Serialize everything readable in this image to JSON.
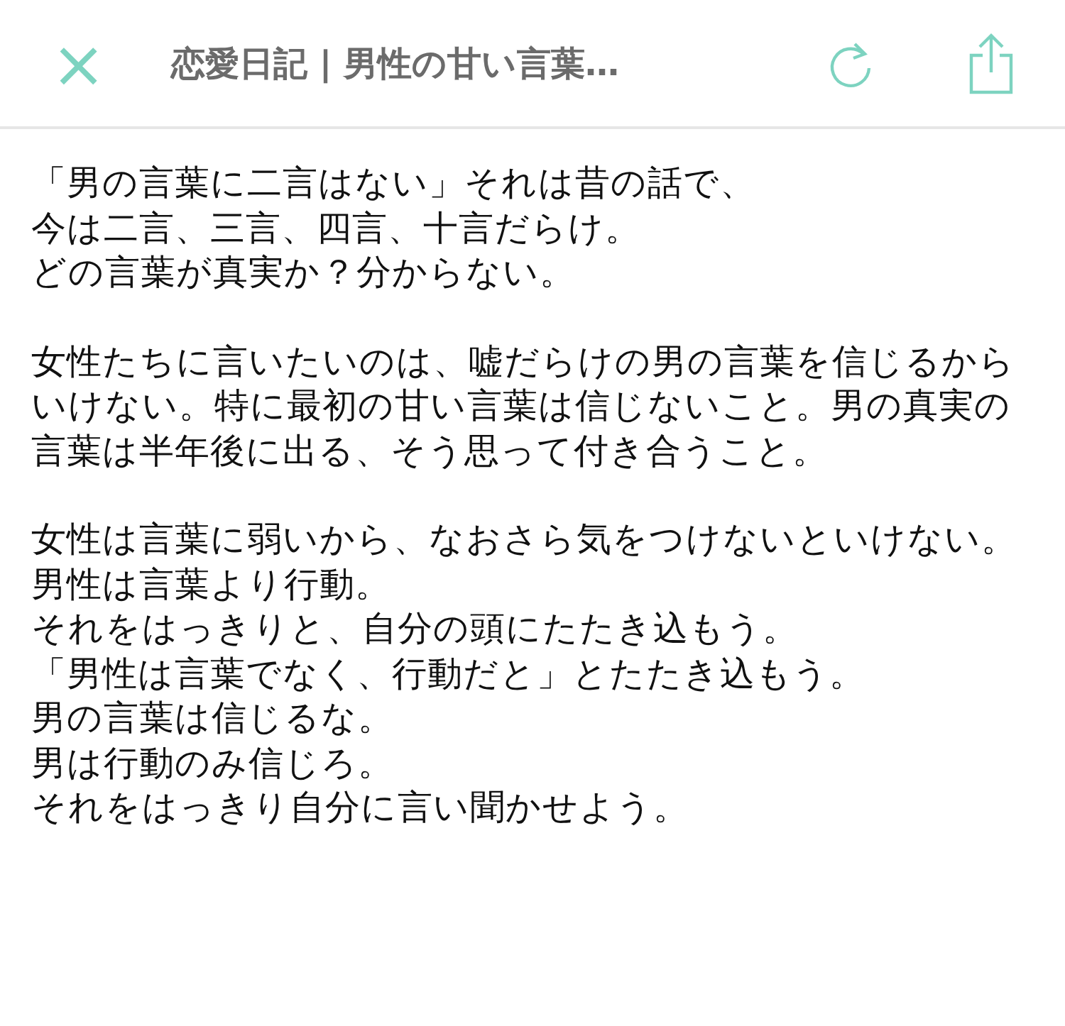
{
  "header": {
    "close": "×",
    "title": "恋愛日記 | 男性の甘い言葉…"
  },
  "paragraphs": [
    [
      "「男の言葉に二言はない」それは昔の話で、",
      "今は二言、三言、四言、十言だらけ。",
      "どの言葉が真実か？分からない。"
    ],
    [
      "女性たちに言いたいのは、嘘だらけの男の言葉を信じるから",
      "いけない。特に最初の甘い言葉は信じないこと。男の真実の",
      "言葉は半年後に出る、そう思って付き合うこと。"
    ],
    [
      "女性は言葉に弱いから、なおさら気をつけないといけない。",
      "男性は言葉より行動。",
      "それをはっきりと、自分の頭にたたき込もう。",
      "「男性は言葉でなく、行動だと」とたたき込もう。",
      "男の言葉は信じるな。",
      "男は行動のみ信じろ。",
      "それをはっきり自分に言い聞かせよう。"
    ]
  ]
}
